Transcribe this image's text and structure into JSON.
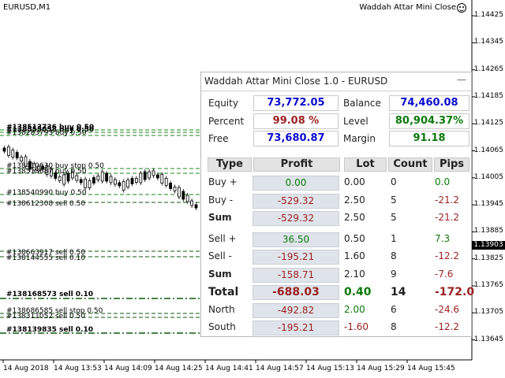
{
  "chart": {
    "symbol": "EURUSD,M1",
    "ea_title": "Waddah Attar Mini Close",
    "current_price": "1.13903",
    "price_ticks": [
      "1.14425",
      "1.14345",
      "1.14265",
      "1.14185",
      "1.14125",
      "1.14065",
      "1.14005",
      "1.13945",
      "1.13885",
      "1.13825",
      "1.13765",
      "1.13705",
      "1.13645"
    ],
    "time_ticks": [
      "14 Aug 2018",
      "14 Aug 13:53",
      "14 Aug 14:09",
      "14 Aug 14:25",
      "14 Aug 14:41",
      "14 Aug 14:57",
      "14 Aug 15:13",
      "14 Aug 15:29",
      "14 Aug 15:45"
    ],
    "order_labels": [
      {
        "text": "#138513736 buy 0.50",
        "bold": true
      },
      {
        "text": "#138555058 buy 0.50",
        "bold": true
      },
      {
        "text": "#138283793 buy 0.50",
        "bold": false
      },
      {
        "text": "#138410630 buy stop 0.50",
        "bold": false
      },
      {
        "text": "#138518687 buy 0.50",
        "bold": false
      },
      {
        "text": "#138540990 buy 0.50",
        "bold": false
      },
      {
        "text": "#138612308 sell 0.50",
        "bold": false
      },
      {
        "text": "#138663917 sell 0.50",
        "bold": false
      },
      {
        "text": "#138144555 sell 0.10",
        "bold": false
      },
      {
        "text": "#138168573 sell 0.10",
        "bold": true
      },
      {
        "text": "#138686585 sell stop 0.50",
        "bold": false
      },
      {
        "text": "#138311052 sell 0.50",
        "bold": false
      },
      {
        "text": "#138139835 sell 0.10",
        "bold": true
      }
    ],
    "colors": {
      "buy_line": "#1a8a1a",
      "sell_line": "#0a5a0a",
      "candle": "#000000"
    }
  },
  "panel": {
    "title": "Waddah Attar Mini Close 1.0  - EURUSD",
    "minimize_icon": "minimize-icon",
    "summary": {
      "equity_label": "Equity",
      "equity_value": "73,772.05",
      "balance_label": "Balance",
      "balance_value": "74,460.08",
      "percent_label": "Percent",
      "percent_value": "99.08 %",
      "level_label": "Level",
      "level_value": "80,904.37%",
      "free_label": "Free",
      "free_value": "73,680.87",
      "margin_label": "Margin",
      "margin_value": "91.18"
    },
    "table": {
      "headers": [
        "Type",
        "Profit",
        "Lot",
        "Count",
        "Pips"
      ],
      "rows": [
        {
          "type": "Buy +",
          "profit": "0.00",
          "lot": "0.00",
          "count": "0",
          "pips": "0.0",
          "bold": false,
          "profit_color": "green",
          "lot_color": "dark",
          "pips_color": "green",
          "gap": false
        },
        {
          "type": "Buy -",
          "profit": "-529.32",
          "lot": "2.50",
          "count": "5",
          "pips": "-21.2",
          "bold": false,
          "profit_color": "red",
          "lot_color": "dark",
          "pips_color": "red",
          "gap": false
        },
        {
          "type": "Sum",
          "profit": "-529.32",
          "lot": "2.50",
          "count": "5",
          "pips": "-21.2",
          "bold": true,
          "profit_color": "red",
          "lot_color": "dark",
          "pips_color": "red",
          "gap": false
        },
        {
          "type": "Sell +",
          "profit": "36.50",
          "lot": "0.50",
          "count": "1",
          "pips": "7.3",
          "bold": false,
          "profit_color": "green",
          "lot_color": "dark",
          "pips_color": "green",
          "gap": true
        },
        {
          "type": "Sell -",
          "profit": "-195.21",
          "lot": "1.60",
          "count": "8",
          "pips": "-12.2",
          "bold": false,
          "profit_color": "red",
          "lot_color": "dark",
          "pips_color": "red",
          "gap": false
        },
        {
          "type": "Sum",
          "profit": "-158.71",
          "lot": "2.10",
          "count": "9",
          "pips": "-7.6",
          "bold": true,
          "profit_color": "red",
          "lot_color": "dark",
          "pips_color": "red",
          "gap": false
        },
        {
          "type": "Total",
          "profit": "-688.03",
          "lot": "0.40",
          "count": "14",
          "pips": "-172.0",
          "bold": true,
          "total": true,
          "profit_color": "red",
          "lot_color": "green",
          "pips_color": "red",
          "gap": false
        },
        {
          "type": "North",
          "profit": "-492.82",
          "lot": "2.00",
          "count": "6",
          "pips": "-24.6",
          "bold": false,
          "profit_color": "red",
          "lot_color": "green",
          "pips_color": "red",
          "gap": false
        },
        {
          "type": "South",
          "profit": "-195.21",
          "lot": "-1.60",
          "count": "8",
          "pips": "-12.2",
          "bold": false,
          "profit_color": "red",
          "lot_color": "red",
          "pips_color": "red",
          "gap": false
        }
      ]
    }
  }
}
